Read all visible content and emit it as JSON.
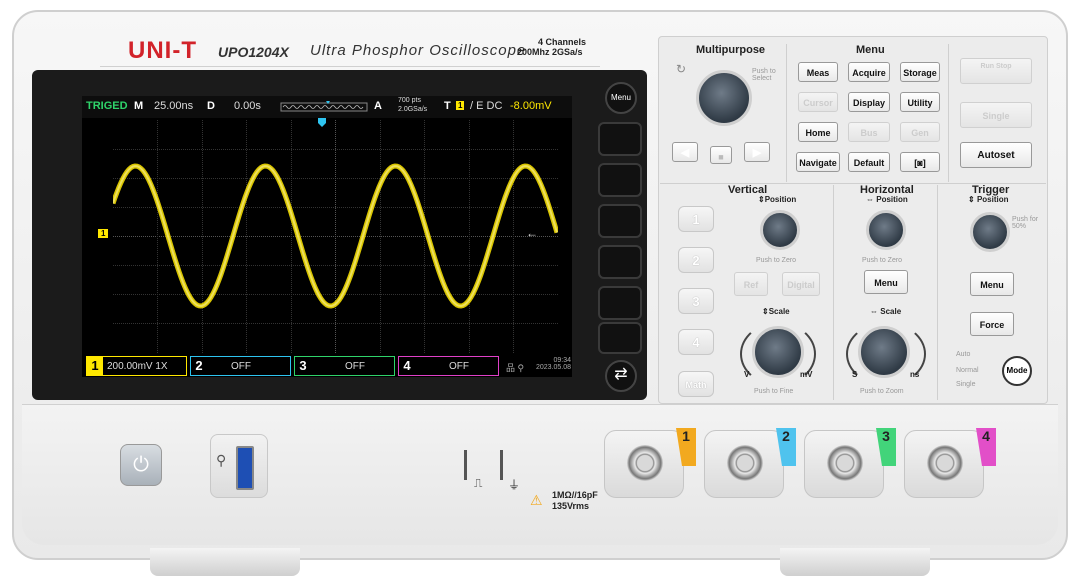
{
  "brand": {
    "logo": "UNI-T",
    "model": "UPO1204X",
    "title": "Ultra Phosphor Oscilloscope",
    "spec_channels": "4 Channels",
    "spec_rate": "200Mhz 2GSa/s"
  },
  "screen": {
    "status": "TRIGED",
    "timebase_label": "M",
    "timebase_value": "25.00ns",
    "delay_label": "D",
    "delay_value": "0.00s",
    "acq_label": "A",
    "acq_pts": "700 pts",
    "acq_rate": "2.0GSa/s",
    "trig_label": "T",
    "trig_info": "/ E DC",
    "trig_level": "-8.00mV",
    "menu_button": "Menu",
    "ch1_marker": "1",
    "trace_color": "#ffe800",
    "channels": [
      {
        "num": "1",
        "value": "200.00mV 1X",
        "color": "#ffe800"
      },
      {
        "num": "2",
        "value": "OFF",
        "color": "#2ec4f0"
      },
      {
        "num": "3",
        "value": "OFF",
        "color": "#2fd36a"
      },
      {
        "num": "4",
        "value": "OFF",
        "color": "#e040c8"
      }
    ],
    "clock_time": "09:34",
    "clock_date": "2023.05.08"
  },
  "panel": {
    "multipurpose": {
      "title": "Multipurpose",
      "hint": "Push to Select"
    },
    "menu": {
      "title": "Menu",
      "keys": [
        "Meas",
        "Acquire",
        "Storage",
        "Cursor",
        "Display",
        "Utility",
        "Home",
        "Bus",
        "Gen",
        "Navigate",
        "Default",
        "[◙]"
      ]
    },
    "run": {
      "run_stop": "Run Stop",
      "single": "Single",
      "autoset": "Autoset"
    },
    "vertical": {
      "title": "Vertical",
      "position": "Position",
      "push_zero": "Push to Zero",
      "ref": "Ref",
      "digital": "Digital",
      "scale": "Scale",
      "v": "V",
      "mv": "mV",
      "push_fine": "Push to Fine",
      "channels": [
        "1",
        "2",
        "3",
        "4"
      ],
      "math": "Math"
    },
    "horizontal": {
      "title": "Horizontal",
      "position": "Position",
      "push_zero": "Push to Zero",
      "menu": "Menu",
      "scale": "Scale",
      "s": "S",
      "ns": "ns",
      "push_zoom": "Push to Zoom"
    },
    "trigger": {
      "title": "Trigger",
      "position": "Position",
      "push_50": "Push for 50%",
      "menu": "Menu",
      "force": "Force",
      "modes": [
        "Auto",
        "Normal",
        "Single"
      ],
      "mode": "Mode"
    }
  },
  "front": {
    "inputs": [
      "1",
      "2",
      "3",
      "4"
    ],
    "warning_line1": "1MΩ//16pF",
    "warning_line2": "135Vrms"
  }
}
